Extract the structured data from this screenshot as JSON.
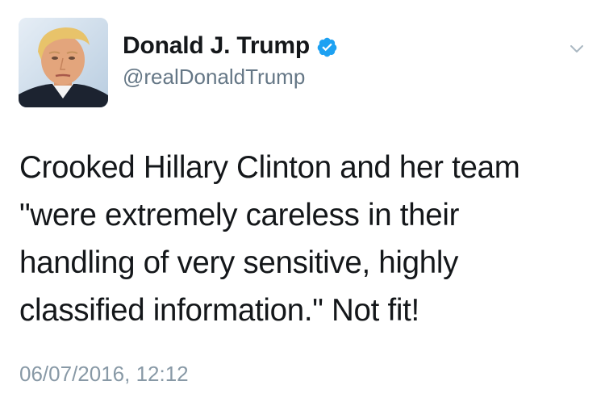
{
  "author": {
    "display_name": "Donald J. Trump",
    "handle": "@realDonaldTrump",
    "verified": true,
    "avatar_icon": "profile-photo"
  },
  "tweet": {
    "text": "Crooked Hillary Clinton and her team\n\"were extremely careless in their\nhandling of very sensitive, highly\nclassified information.\" Not fit!",
    "timestamp": "06/07/2016, 12:12"
  },
  "menu": {
    "icon": "chevron-down-icon"
  },
  "colors": {
    "text": "#14171a",
    "secondary": "#657786",
    "timestamp": "#8899a6",
    "verified": "#1da1f2",
    "chevron": "#aab8c2"
  }
}
